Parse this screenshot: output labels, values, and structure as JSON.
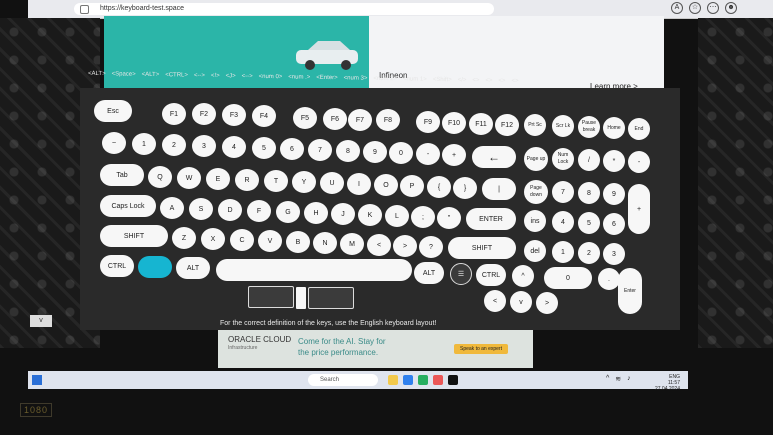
{
  "browser": {
    "url": "https://keyboard-test.space",
    "icons": [
      "A",
      "☆",
      "⋯",
      "☻"
    ]
  },
  "top_ad": {
    "brand": "Infineon",
    "learn_more": "Learn more  >"
  },
  "key_strip": [
    "<ALT>",
    "<Space>",
    "<ALT>",
    "<CTRL>",
    "<-->",
    "<!>",
    "<J>",
    "<-->",
    "<num 0>",
    "<num .>",
    "<Enter>",
    "<num 3>",
    "<num 2>",
    "<num 1>",
    "<Shift>",
    "</>",
    "<>",
    "<>",
    "<>",
    "<>"
  ],
  "keys": {
    "row1": [
      "Esc",
      "F1",
      "F2",
      "F3",
      "F4",
      "F5",
      "F6",
      "F7",
      "F8",
      "F9",
      "F10",
      "F11",
      "F12",
      "Prt Sc",
      "Scr Lk",
      "Pause break",
      "Home",
      "End"
    ],
    "row2": [
      "~",
      "1",
      "2",
      "3",
      "4",
      "5",
      "6",
      "7",
      "8",
      "9",
      "0",
      "-",
      "+",
      "←",
      "Page up",
      "Num Lock",
      "/",
      "*",
      "-"
    ],
    "row3": [
      "Tab",
      "Q",
      "W",
      "E",
      "R",
      "T",
      "Y",
      "U",
      "I",
      "O",
      "P",
      "{",
      "}",
      "|",
      "Page down",
      "7",
      "8",
      "9",
      "+"
    ],
    "row4": [
      "Caps Lock",
      "A",
      "S",
      "D",
      "F",
      "G",
      "H",
      "J",
      "K",
      "L",
      ";",
      "\"",
      "ENTER",
      "ins",
      "4",
      "5",
      "6"
    ],
    "row5": [
      "SHIFT",
      "Z",
      "X",
      "C",
      "V",
      "B",
      "N",
      "M",
      "<",
      ">",
      "?",
      "SHIFT",
      "del",
      "1",
      "2",
      "3"
    ],
    "row6": [
      "CTRL",
      "",
      "ALT",
      "",
      "ALT",
      "☰",
      "CTRL",
      "^",
      "0",
      ".",
      "Enter"
    ],
    "arrows": [
      "<",
      "v",
      ">"
    ]
  },
  "note": "For the correct definition of the keys, use the English keyboard layout!",
  "bottom_ad": {
    "brand": "ORACLE CLOUD",
    "brand_sub": "Infrastructure",
    "line1": "Come for the AI. Stay for",
    "line2": "the price performance.",
    "cta": "Speak to an expert"
  },
  "collapse_label": "v",
  "taskbar": {
    "search": "Search",
    "time": "11:57",
    "date": "27.04.2024",
    "lang": "ENG"
  },
  "bezel": "1080"
}
